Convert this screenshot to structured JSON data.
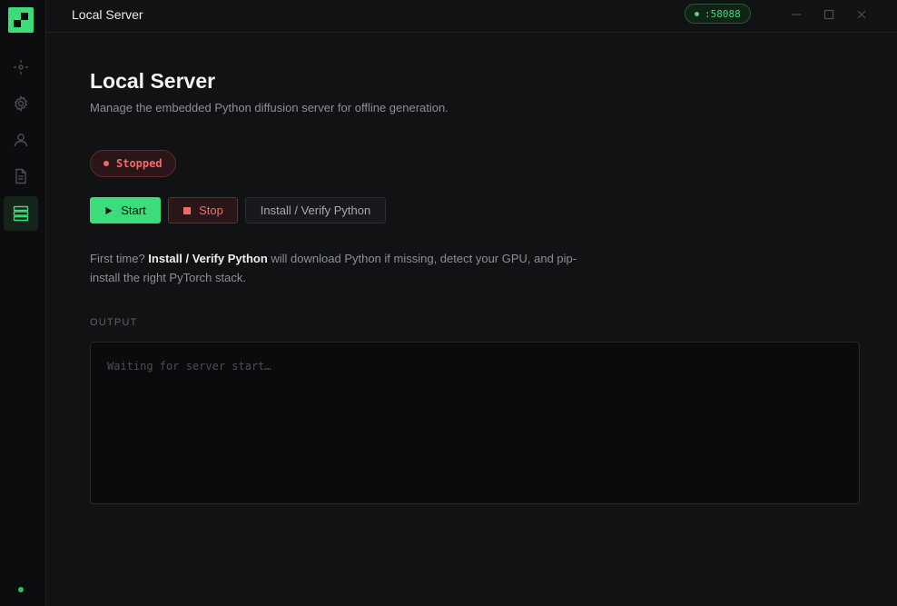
{
  "window": {
    "title": "Local Server",
    "port": ":58088"
  },
  "sidebar": {
    "items": [
      {
        "icon": "target-icon",
        "active": false
      },
      {
        "icon": "gear-icon",
        "active": false
      },
      {
        "icon": "user-icon",
        "active": false
      },
      {
        "icon": "document-icon",
        "active": false
      },
      {
        "icon": "server-icon",
        "active": true
      }
    ]
  },
  "page": {
    "title": "Local Server",
    "subtitle": "Manage the embedded Python diffusion server for offline generation.",
    "status": "Stopped",
    "buttons": {
      "start": "Start",
      "stop": "Stop",
      "install": "Install / Verify Python"
    },
    "hint": {
      "prefix": "First time? ",
      "bold": "Install / Verify Python",
      "suffix": " will download Python if missing, detect your GPU, and pip-install the right PyTorch stack."
    },
    "output_label": "OUTPUT",
    "output_placeholder": "Waiting for server start…"
  },
  "colors": {
    "accent": "#3ddc7a",
    "danger": "#f06a6a",
    "background": "#111214"
  }
}
